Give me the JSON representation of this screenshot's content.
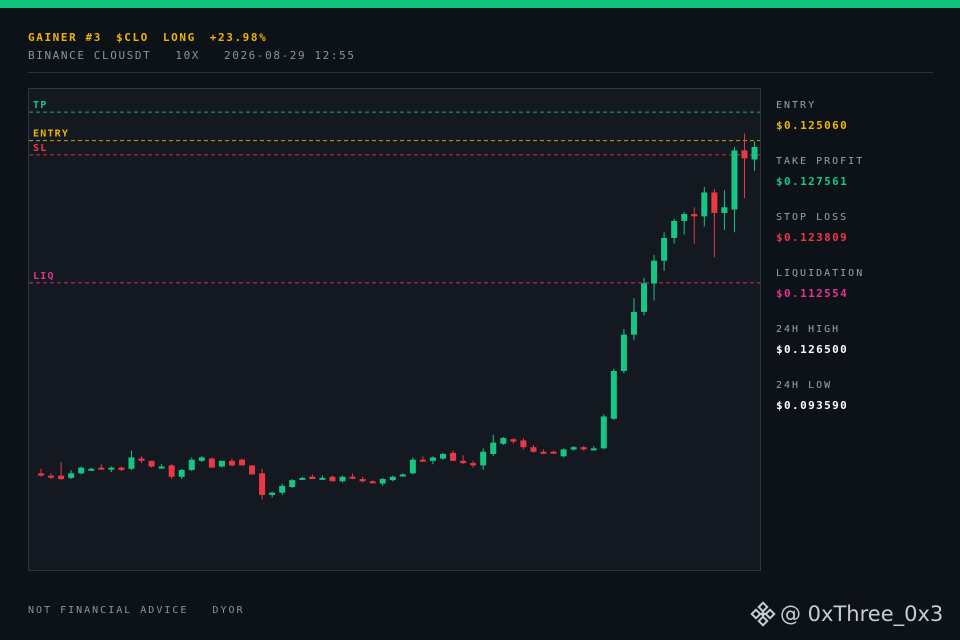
{
  "header": {
    "title": "GAINER #3",
    "symbol": "$CLO",
    "side": "LONG",
    "change": "+23.98%",
    "exchange": "BINANCE CLOUSDT",
    "leverage": "10X",
    "datetime": "2026-08-29 12:55"
  },
  "stats": [
    {
      "label": "ENTRY",
      "value": "$0.125060",
      "color": "#f0b400"
    },
    {
      "label": "TAKE PROFIT",
      "value": "$0.127561",
      "color": "#16c784"
    },
    {
      "label": "STOP LOSS",
      "value": "$0.123809",
      "color": "#ea3943"
    },
    {
      "label": "LIQUIDATION",
      "value": "$0.112554",
      "color": "#e0338c"
    },
    {
      "label": "24H HIGH",
      "value": "$0.126500",
      "color": "#ffffff"
    },
    {
      "label": "24H LOW",
      "value": "$0.093590",
      "color": "#ffffff"
    }
  ],
  "footer": {
    "text1": "NOT FINANCIAL ADVICE",
    "text2": "DYOR"
  },
  "watermark": {
    "handle": "@ 0xThree_0x3",
    "icon": "binance-logo-icon"
  },
  "colors": {
    "up": "#16c784",
    "down": "#ea3943",
    "entry": "#f0b400",
    "tp": "#16c784",
    "sl": "#ea3943",
    "liq": "#e0338c",
    "accent": "#10c47c"
  },
  "chart_data": {
    "type": "candlestick",
    "y_range": [
      0.0873,
      0.1296
    ],
    "levels": [
      {
        "label": "TP",
        "price": 0.127561,
        "color": "#16c784"
      },
      {
        "label": "ENTRY",
        "price": 0.12506,
        "color": "#f0b400"
      },
      {
        "label": "SL",
        "price": 0.123809,
        "color": "#ea3943"
      },
      {
        "label": "LIQ",
        "price": 0.112554,
        "color": "#e0338c"
      }
    ],
    "candles": [
      [
        0.0958,
        0.0962,
        0.0955,
        0.0956
      ],
      [
        0.0956,
        0.0958,
        0.0953,
        0.0955
      ],
      [
        0.0956,
        0.0968,
        0.0952,
        0.0953
      ],
      [
        0.0954,
        0.0961,
        0.0953,
        0.0958
      ],
      [
        0.0958,
        0.0964,
        0.0957,
        0.0963
      ],
      [
        0.0962,
        0.0963,
        0.096,
        0.0962
      ],
      [
        0.0963,
        0.0966,
        0.0961,
        0.0962
      ],
      [
        0.0962,
        0.0964,
        0.0959,
        0.0963
      ],
      [
        0.0963,
        0.0964,
        0.096,
        0.0961
      ],
      [
        0.0962,
        0.0978,
        0.0961,
        0.0972
      ],
      [
        0.0971,
        0.0973,
        0.0967,
        0.0969
      ],
      [
        0.0969,
        0.0969,
        0.0963,
        0.0964
      ],
      [
        0.0963,
        0.0966,
        0.0962,
        0.0964
      ],
      [
        0.0965,
        0.0966,
        0.0953,
        0.0955
      ],
      [
        0.0955,
        0.0962,
        0.0953,
        0.0961
      ],
      [
        0.0961,
        0.0972,
        0.096,
        0.097
      ],
      [
        0.0969,
        0.0973,
        0.0968,
        0.0972
      ],
      [
        0.0971,
        0.0972,
        0.0963,
        0.0963
      ],
      [
        0.0964,
        0.0969,
        0.0963,
        0.0969
      ],
      [
        0.0969,
        0.0971,
        0.0964,
        0.0965
      ],
      [
        0.097,
        0.0971,
        0.0965,
        0.0965
      ],
      [
        0.0965,
        0.0965,
        0.0957,
        0.0957
      ],
      [
        0.0958,
        0.0962,
        0.0935,
        0.0939
      ],
      [
        0.0939,
        0.0942,
        0.0937,
        0.0941
      ],
      [
        0.0941,
        0.0949,
        0.0939,
        0.0947
      ],
      [
        0.0946,
        0.0953,
        0.0945,
        0.0952
      ],
      [
        0.0953,
        0.0955,
        0.0952,
        0.0954
      ],
      [
        0.0955,
        0.0957,
        0.0953,
        0.0953
      ],
      [
        0.0954,
        0.0956,
        0.0953,
        0.0954
      ],
      [
        0.0955,
        0.0956,
        0.0951,
        0.0951
      ],
      [
        0.0951,
        0.0956,
        0.095,
        0.0955
      ],
      [
        0.0955,
        0.0958,
        0.0953,
        0.0954
      ],
      [
        0.0953,
        0.0955,
        0.095,
        0.0951
      ],
      [
        0.0951,
        0.0952,
        0.0949,
        0.095
      ],
      [
        0.0949,
        0.0954,
        0.0947,
        0.0953
      ],
      [
        0.0952,
        0.0956,
        0.0951,
        0.0955
      ],
      [
        0.0956,
        0.0958,
        0.0955,
        0.0957
      ],
      [
        0.0958,
        0.0972,
        0.0957,
        0.097
      ],
      [
        0.097,
        0.0973,
        0.0968,
        0.0969
      ],
      [
        0.0969,
        0.0973,
        0.0966,
        0.0972
      ],
      [
        0.0971,
        0.0976,
        0.097,
        0.0975
      ],
      [
        0.0976,
        0.0978,
        0.0969,
        0.0969
      ],
      [
        0.0969,
        0.0974,
        0.0966,
        0.0967
      ],
      [
        0.0967,
        0.0969,
        0.0963,
        0.0965
      ],
      [
        0.0965,
        0.098,
        0.0961,
        0.0977
      ],
      [
        0.0975,
        0.0992,
        0.0973,
        0.0985
      ],
      [
        0.0984,
        0.099,
        0.0983,
        0.0989
      ],
      [
        0.0988,
        0.0989,
        0.0984,
        0.0986
      ],
      [
        0.0987,
        0.0989,
        0.0979,
        0.0981
      ],
      [
        0.0981,
        0.0983,
        0.0976,
        0.0977
      ],
      [
        0.0977,
        0.0979,
        0.0975,
        0.0976
      ],
      [
        0.0977,
        0.0978,
        0.0975,
        0.0976
      ],
      [
        0.0973,
        0.098,
        0.0972,
        0.0979
      ],
      [
        0.0979,
        0.0982,
        0.0978,
        0.0981
      ],
      [
        0.0981,
        0.0982,
        0.0978,
        0.0979
      ],
      [
        0.0979,
        0.0982,
        0.0978,
        0.098
      ],
      [
        0.098,
        0.101,
        0.0979,
        0.1008
      ],
      [
        0.1006,
        0.105,
        0.1005,
        0.1048
      ],
      [
        0.1048,
        0.1085,
        0.1046,
        0.108
      ],
      [
        0.108,
        0.1112,
        0.1075,
        0.11
      ],
      [
        0.11,
        0.113,
        0.1097,
        0.1125
      ],
      [
        0.1125,
        0.115,
        0.111,
        0.1145
      ],
      [
        0.1145,
        0.117,
        0.1136,
        0.1165
      ],
      [
        0.1165,
        0.1182,
        0.116,
        0.118
      ],
      [
        0.118,
        0.1188,
        0.1168,
        0.1186
      ],
      [
        0.1186,
        0.1192,
        0.116,
        0.1184
      ],
      [
        0.1184,
        0.121,
        0.1175,
        0.1205
      ],
      [
        0.1205,
        0.1208,
        0.1148,
        0.1187
      ],
      [
        0.1187,
        0.1207,
        0.1172,
        0.1192
      ],
      [
        0.119,
        0.1245,
        0.117,
        0.1242
      ],
      [
        0.1242,
        0.1257,
        0.12,
        0.1235
      ],
      [
        0.1234,
        0.125,
        0.1224,
        0.1245
      ],
      [
        0.1245,
        0.1249,
        0.1235,
        0.1248
      ]
    ]
  }
}
